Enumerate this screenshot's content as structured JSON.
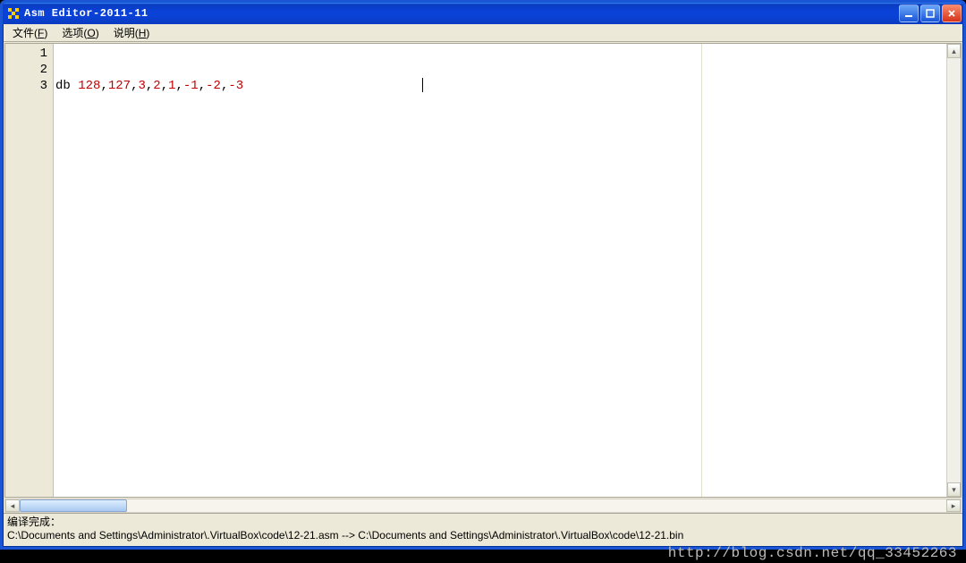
{
  "window": {
    "title": "Asm Editor-2011-11"
  },
  "menubar": {
    "file": {
      "label": "文件",
      "accel": "F"
    },
    "options": {
      "label": "选项",
      "accel": "O"
    },
    "help": {
      "label": "说明",
      "accel": "H"
    }
  },
  "editor": {
    "gutter": [
      "1",
      "2",
      "3"
    ],
    "lines": [
      {
        "tokens": []
      },
      {
        "tokens": []
      },
      {
        "tokens": [
          {
            "t": "db ",
            "c": "kw"
          },
          {
            "t": "128",
            "c": "num"
          },
          {
            "t": ",",
            "c": "kw"
          },
          {
            "t": "127",
            "c": "num"
          },
          {
            "t": ",",
            "c": "kw"
          },
          {
            "t": "3",
            "c": "num"
          },
          {
            "t": ",",
            "c": "kw"
          },
          {
            "t": "2",
            "c": "num"
          },
          {
            "t": ",",
            "c": "kw"
          },
          {
            "t": "1",
            "c": "num"
          },
          {
            "t": ",",
            "c": "kw"
          },
          {
            "t": "-1",
            "c": "num"
          },
          {
            "t": ",",
            "c": "kw"
          },
          {
            "t": "-2",
            "c": "num"
          },
          {
            "t": ",",
            "c": "kw"
          },
          {
            "t": "-3",
            "c": "num"
          }
        ]
      }
    ]
  },
  "status": {
    "line1": "编译完成：",
    "line2": "C:\\Documents and Settings\\Administrator\\.VirtualBox\\code\\12-21.asm --> C:\\Documents and Settings\\Administrator\\.VirtualBox\\code\\12-21.bin"
  },
  "watermark": "http://blog.csdn.net/qq_33452263",
  "scroll": {
    "up": "▴",
    "down": "▾",
    "left": "◂",
    "right": "▸"
  }
}
